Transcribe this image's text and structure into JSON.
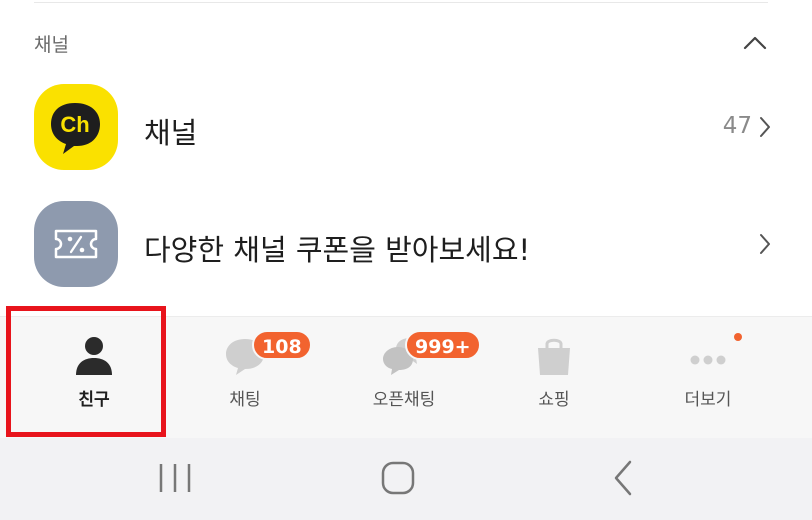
{
  "section": {
    "title": "채널"
  },
  "rows": [
    {
      "label": "채널",
      "count": "47",
      "icon": "channel-logo-icon",
      "icon_text": "Ch",
      "icon_color": "#fae100"
    },
    {
      "label": "다양한 채널 쿠폰을 받아보세요!",
      "icon": "coupon-icon",
      "icon_color": "#8e9aae"
    }
  ],
  "tabs": [
    {
      "label": "친구",
      "icon": "person-icon",
      "active": true
    },
    {
      "label": "채팅",
      "icon": "chat-bubble-icon",
      "badge": "108"
    },
    {
      "label": "오픈채팅",
      "icon": "open-chat-icon",
      "badge": "999+"
    },
    {
      "label": "쇼핑",
      "icon": "shopping-bag-icon"
    },
    {
      "label": "더보기",
      "icon": "more-dots-icon",
      "new_dot": true
    }
  ],
  "colors": {
    "badge": "#f2632f",
    "highlight": "#e8141c",
    "channel_yellow": "#fae100"
  },
  "navbar": [
    "recent-apps-icon",
    "home-icon",
    "back-icon"
  ]
}
